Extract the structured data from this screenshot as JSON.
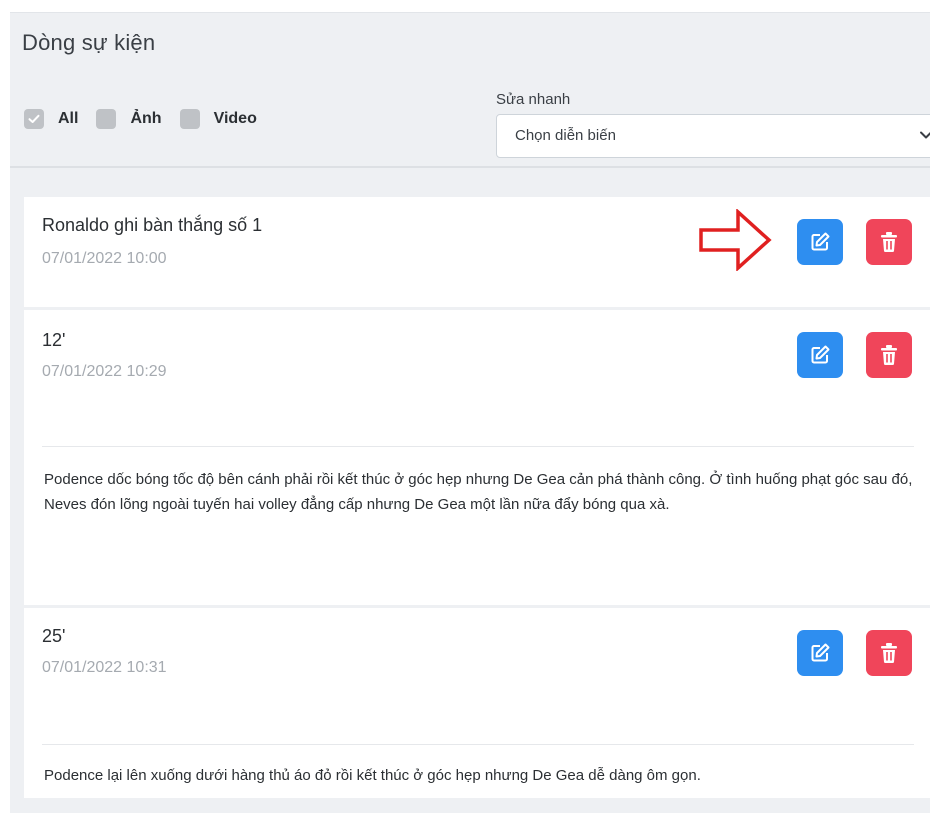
{
  "panel": {
    "title": "Dòng sự kiện"
  },
  "filters": [
    {
      "label": "All",
      "checked": true
    },
    {
      "label": "Ảnh",
      "checked": false
    },
    {
      "label": "Video",
      "checked": false
    }
  ],
  "quick_edit": {
    "label": "Sửa nhanh",
    "selected": "Chọn diễn biến"
  },
  "icons": {
    "check": "check-icon",
    "chevron": "chevron-down-icon",
    "edit": "edit-icon",
    "delete": "trash-icon",
    "annotation": "arrow-right-icon"
  },
  "colors": {
    "edit_button": "#2e8ef0",
    "delete_button": "#f0455a",
    "annotation_arrow": "#e02020"
  },
  "events": [
    {
      "title": "Ronaldo ghi bàn thắng số 1",
      "time": "07/01/2022 10:00",
      "description": ""
    },
    {
      "title": "12'",
      "time": "07/01/2022 10:29",
      "description": "Podence dốc bóng tốc độ bên cánh phải rồi kết thúc ở góc hẹp nhưng De Gea cản phá thành công. Ở tình huống phạt góc sau đó, Neves đón lõng ngoài tuyến hai volley đẳng cấp nhưng De Gea một lần nữa đẩy bóng qua xà."
    },
    {
      "title": "25'",
      "time": "07/01/2022 10:31",
      "description": "Podence lại lên xuống dưới hàng thủ áo đỏ rồi kết thúc ở góc hẹp nhưng De Gea dễ dàng ôm gọn."
    }
  ]
}
